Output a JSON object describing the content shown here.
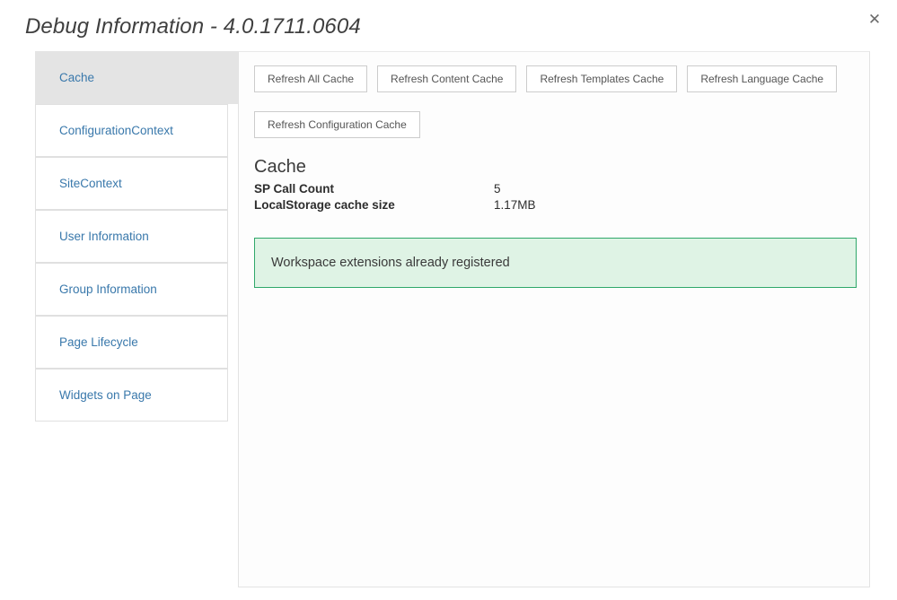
{
  "dialog": {
    "title": "Debug Information - 4.0.1711.0604",
    "close_icon": "close-icon",
    "close_glyph": "✕"
  },
  "sidebar": {
    "items": [
      {
        "label": "Cache",
        "active": true
      },
      {
        "label": "ConfigurationContext",
        "active": false
      },
      {
        "label": "SiteContext",
        "active": false
      },
      {
        "label": "User Information",
        "active": false
      },
      {
        "label": "Group Information",
        "active": false
      },
      {
        "label": "Page Lifecycle",
        "active": false
      },
      {
        "label": "Widgets on Page",
        "active": false
      }
    ]
  },
  "content": {
    "buttons_row1": [
      "Refresh All Cache",
      "Refresh Content Cache",
      "Refresh Templates Cache",
      "Refresh Language Cache"
    ],
    "buttons_row2": [
      "Refresh Configuration Cache"
    ],
    "section_heading": "Cache",
    "details": [
      {
        "key": "SP Call Count",
        "value": "5"
      },
      {
        "key": "LocalStorage cache size",
        "value": "1.17MB"
      }
    ],
    "alert": {
      "text": "Workspace extensions already registered",
      "type": "success"
    }
  },
  "colors": {
    "link": "#3978ab",
    "active_item_bg": "#e4e4e4",
    "alert_bg": "#dff3e5",
    "alert_border": "#2fa76a",
    "button_border": "#cccccc",
    "panel_border": "#e3e3e3"
  }
}
